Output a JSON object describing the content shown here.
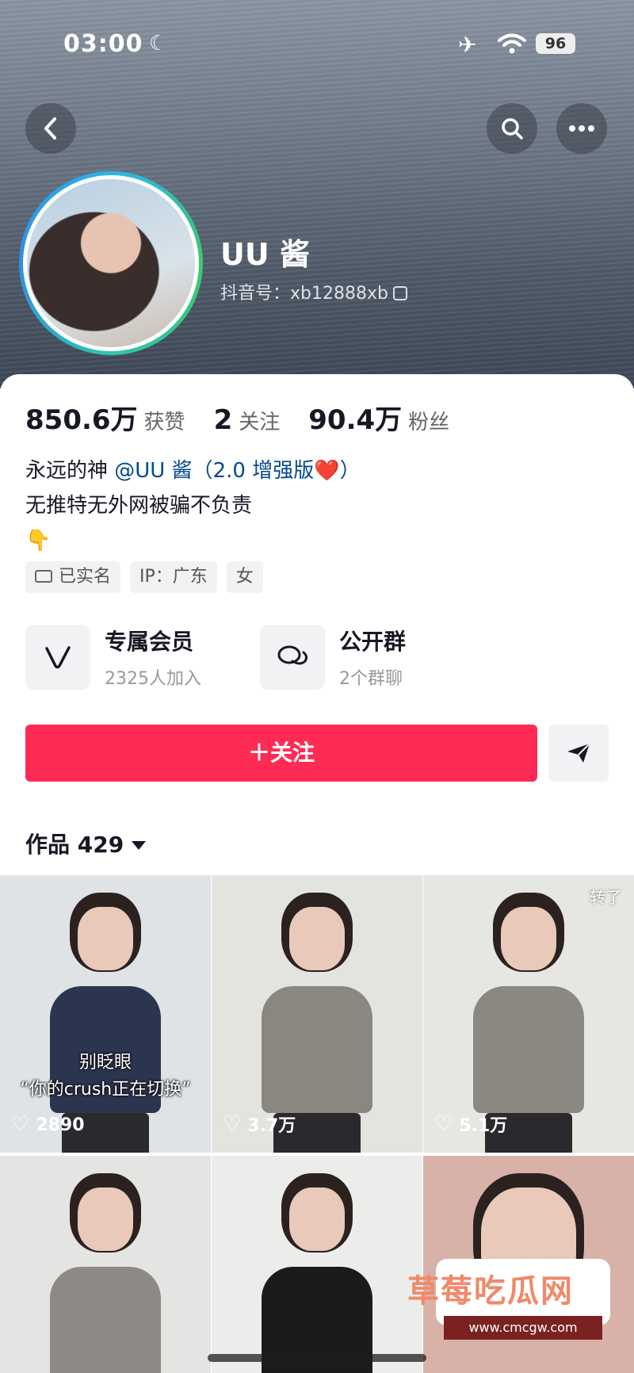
{
  "status_bar": {
    "time": "03:00",
    "battery": "96"
  },
  "profile": {
    "name": "UU 酱",
    "douyin_id": "抖音号：xb12888xb"
  },
  "stats": [
    {
      "value": "850.6万",
      "label": "获赞"
    },
    {
      "value": "2",
      "label": "关注"
    },
    {
      "value": "90.4万",
      "label": "粉丝"
    }
  ],
  "bio": {
    "line1_prefix": "永远的神 ",
    "line1_mention": "@UU 酱（2.0 增强版❤️）",
    "line2": "无推特无外网被骗不负责",
    "line3": "👇"
  },
  "tags": [
    "已实名",
    "IP：广东",
    "女"
  ],
  "features": [
    {
      "title": "专属会员",
      "sub": "2325人加入",
      "icon": "v-membership-icon"
    },
    {
      "title": "公开群",
      "sub": "2个群聊",
      "icon": "group-chat-icon"
    }
  ],
  "buttons": {
    "follow": "＋关注"
  },
  "works": {
    "title": "作品 429"
  },
  "videos": [
    {
      "likes": "2890",
      "caption_line1": "别眨眼",
      "caption_line2": "“你的crush正在切换”",
      "shirt": "#2c3550",
      "bg": "#dfe3e6"
    },
    {
      "likes": "3.7万",
      "shirt": "#8a8780",
      "bg": "#e3e3e0"
    },
    {
      "likes": "5.1万",
      "corner": "转了",
      "shirt": "#8b8882",
      "bg": "#e6e6e3"
    },
    {
      "shirt": "#8d8a85",
      "bg": "#e4e4e2"
    },
    {
      "shirt": "#1b1b1e",
      "bg": "#ececea"
    },
    {
      "shirt": "#e8c6b8",
      "bg": "#d8b2a8"
    }
  ],
  "watermark": {
    "title": "草莓吃瓜网",
    "url": "www.cmcgw.com"
  }
}
